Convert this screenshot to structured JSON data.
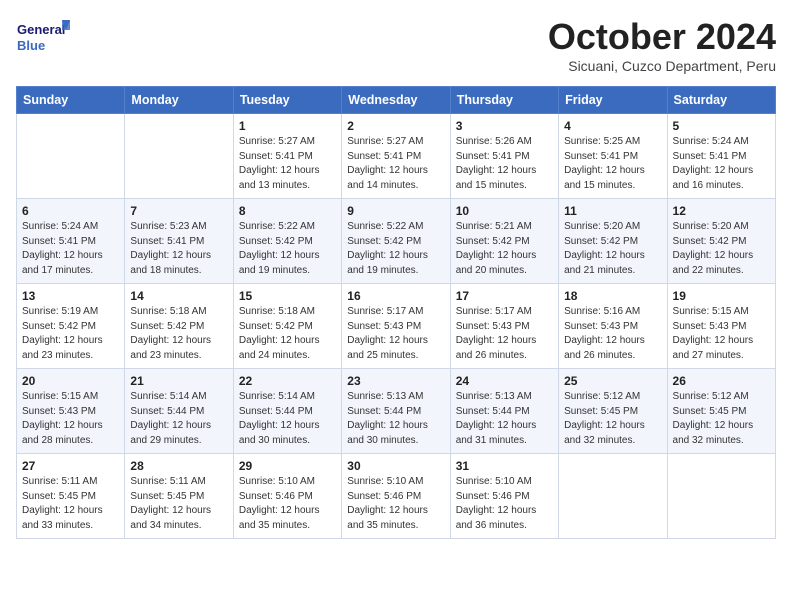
{
  "header": {
    "logo_line1": "General",
    "logo_line2": "Blue",
    "month": "October 2024",
    "location": "Sicuani, Cuzco Department, Peru"
  },
  "days_of_week": [
    "Sunday",
    "Monday",
    "Tuesday",
    "Wednesday",
    "Thursday",
    "Friday",
    "Saturday"
  ],
  "weeks": [
    [
      {
        "day": "",
        "info": ""
      },
      {
        "day": "",
        "info": ""
      },
      {
        "day": "1",
        "info": "Sunrise: 5:27 AM\nSunset: 5:41 PM\nDaylight: 12 hours and 13 minutes."
      },
      {
        "day": "2",
        "info": "Sunrise: 5:27 AM\nSunset: 5:41 PM\nDaylight: 12 hours and 14 minutes."
      },
      {
        "day": "3",
        "info": "Sunrise: 5:26 AM\nSunset: 5:41 PM\nDaylight: 12 hours and 15 minutes."
      },
      {
        "day": "4",
        "info": "Sunrise: 5:25 AM\nSunset: 5:41 PM\nDaylight: 12 hours and 15 minutes."
      },
      {
        "day": "5",
        "info": "Sunrise: 5:24 AM\nSunset: 5:41 PM\nDaylight: 12 hours and 16 minutes."
      }
    ],
    [
      {
        "day": "6",
        "info": "Sunrise: 5:24 AM\nSunset: 5:41 PM\nDaylight: 12 hours and 17 minutes."
      },
      {
        "day": "7",
        "info": "Sunrise: 5:23 AM\nSunset: 5:41 PM\nDaylight: 12 hours and 18 minutes."
      },
      {
        "day": "8",
        "info": "Sunrise: 5:22 AM\nSunset: 5:42 PM\nDaylight: 12 hours and 19 minutes."
      },
      {
        "day": "9",
        "info": "Sunrise: 5:22 AM\nSunset: 5:42 PM\nDaylight: 12 hours and 19 minutes."
      },
      {
        "day": "10",
        "info": "Sunrise: 5:21 AM\nSunset: 5:42 PM\nDaylight: 12 hours and 20 minutes."
      },
      {
        "day": "11",
        "info": "Sunrise: 5:20 AM\nSunset: 5:42 PM\nDaylight: 12 hours and 21 minutes."
      },
      {
        "day": "12",
        "info": "Sunrise: 5:20 AM\nSunset: 5:42 PM\nDaylight: 12 hours and 22 minutes."
      }
    ],
    [
      {
        "day": "13",
        "info": "Sunrise: 5:19 AM\nSunset: 5:42 PM\nDaylight: 12 hours and 23 minutes."
      },
      {
        "day": "14",
        "info": "Sunrise: 5:18 AM\nSunset: 5:42 PM\nDaylight: 12 hours and 23 minutes."
      },
      {
        "day": "15",
        "info": "Sunrise: 5:18 AM\nSunset: 5:42 PM\nDaylight: 12 hours and 24 minutes."
      },
      {
        "day": "16",
        "info": "Sunrise: 5:17 AM\nSunset: 5:43 PM\nDaylight: 12 hours and 25 minutes."
      },
      {
        "day": "17",
        "info": "Sunrise: 5:17 AM\nSunset: 5:43 PM\nDaylight: 12 hours and 26 minutes."
      },
      {
        "day": "18",
        "info": "Sunrise: 5:16 AM\nSunset: 5:43 PM\nDaylight: 12 hours and 26 minutes."
      },
      {
        "day": "19",
        "info": "Sunrise: 5:15 AM\nSunset: 5:43 PM\nDaylight: 12 hours and 27 minutes."
      }
    ],
    [
      {
        "day": "20",
        "info": "Sunrise: 5:15 AM\nSunset: 5:43 PM\nDaylight: 12 hours and 28 minutes."
      },
      {
        "day": "21",
        "info": "Sunrise: 5:14 AM\nSunset: 5:44 PM\nDaylight: 12 hours and 29 minutes."
      },
      {
        "day": "22",
        "info": "Sunrise: 5:14 AM\nSunset: 5:44 PM\nDaylight: 12 hours and 30 minutes."
      },
      {
        "day": "23",
        "info": "Sunrise: 5:13 AM\nSunset: 5:44 PM\nDaylight: 12 hours and 30 minutes."
      },
      {
        "day": "24",
        "info": "Sunrise: 5:13 AM\nSunset: 5:44 PM\nDaylight: 12 hours and 31 minutes."
      },
      {
        "day": "25",
        "info": "Sunrise: 5:12 AM\nSunset: 5:45 PM\nDaylight: 12 hours and 32 minutes."
      },
      {
        "day": "26",
        "info": "Sunrise: 5:12 AM\nSunset: 5:45 PM\nDaylight: 12 hours and 32 minutes."
      }
    ],
    [
      {
        "day": "27",
        "info": "Sunrise: 5:11 AM\nSunset: 5:45 PM\nDaylight: 12 hours and 33 minutes."
      },
      {
        "day": "28",
        "info": "Sunrise: 5:11 AM\nSunset: 5:45 PM\nDaylight: 12 hours and 34 minutes."
      },
      {
        "day": "29",
        "info": "Sunrise: 5:10 AM\nSunset: 5:46 PM\nDaylight: 12 hours and 35 minutes."
      },
      {
        "day": "30",
        "info": "Sunrise: 5:10 AM\nSunset: 5:46 PM\nDaylight: 12 hours and 35 minutes."
      },
      {
        "day": "31",
        "info": "Sunrise: 5:10 AM\nSunset: 5:46 PM\nDaylight: 12 hours and 36 minutes."
      },
      {
        "day": "",
        "info": ""
      },
      {
        "day": "",
        "info": ""
      }
    ]
  ]
}
